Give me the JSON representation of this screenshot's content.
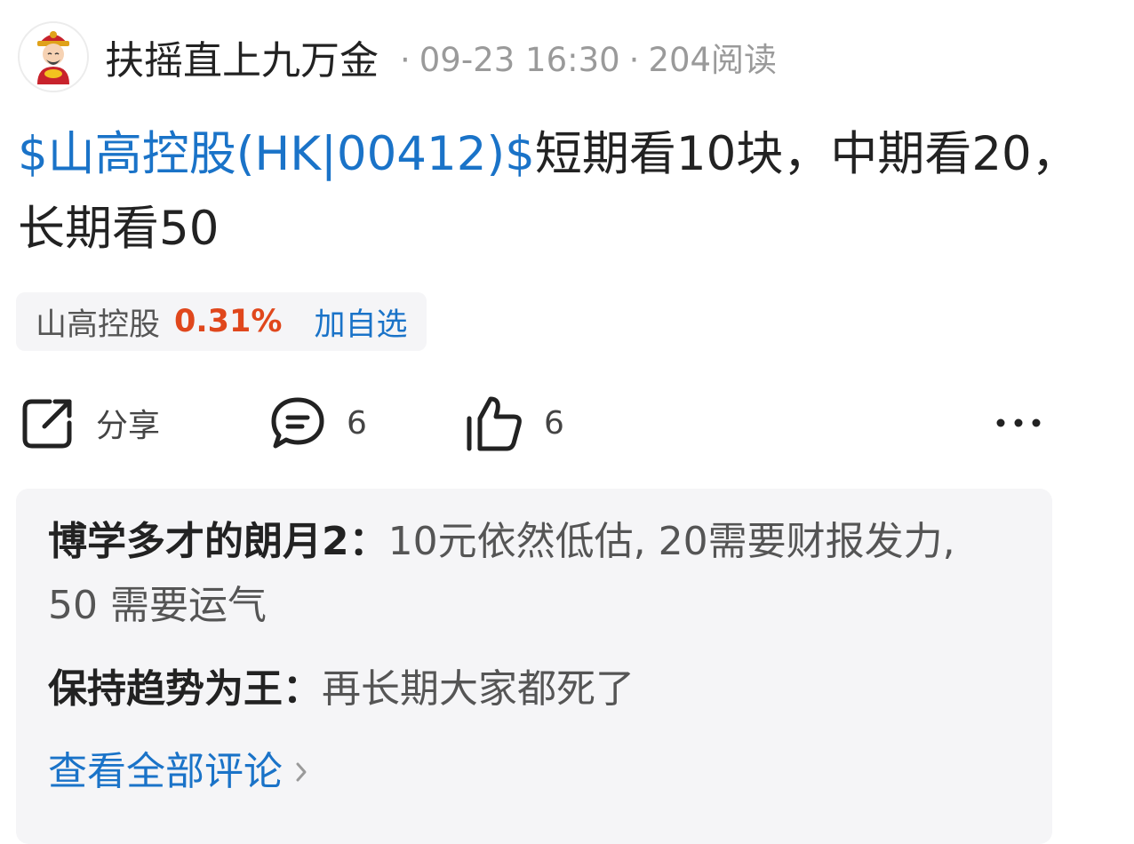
{
  "header": {
    "avatar_icon": "caishen-avatar-icon",
    "author": "扶摇直上九万金",
    "separator": "·",
    "timestamp": "09-23 16:30",
    "reads": "204阅读"
  },
  "post": {
    "stock_tag": "$山高控股(HK|00412)$",
    "text": "短期看10块，中期看20，长期看50"
  },
  "stock_chip": {
    "name": "山高控股",
    "change": "0.31%",
    "add_label": "加自选"
  },
  "actions": {
    "share_label": "分享",
    "comment_count": "6",
    "like_count": "6",
    "share_icon": "share-icon",
    "comment_icon": "comment-icon",
    "like_icon": "thumbs-up-icon",
    "more_icon": "more-icon"
  },
  "comments": [
    {
      "user": "博学多才的朗月2：",
      "text": "10元依然低估, 20需要财报发力, 50 需要运气"
    },
    {
      "user": "保持趋势为王：",
      "text": "再长期大家都死了"
    }
  ],
  "view_all_label": "查看全部评论",
  "colors": {
    "link": "#1a73c8",
    "change_up": "#e0471c",
    "chip_bg": "#f5f5f7"
  }
}
